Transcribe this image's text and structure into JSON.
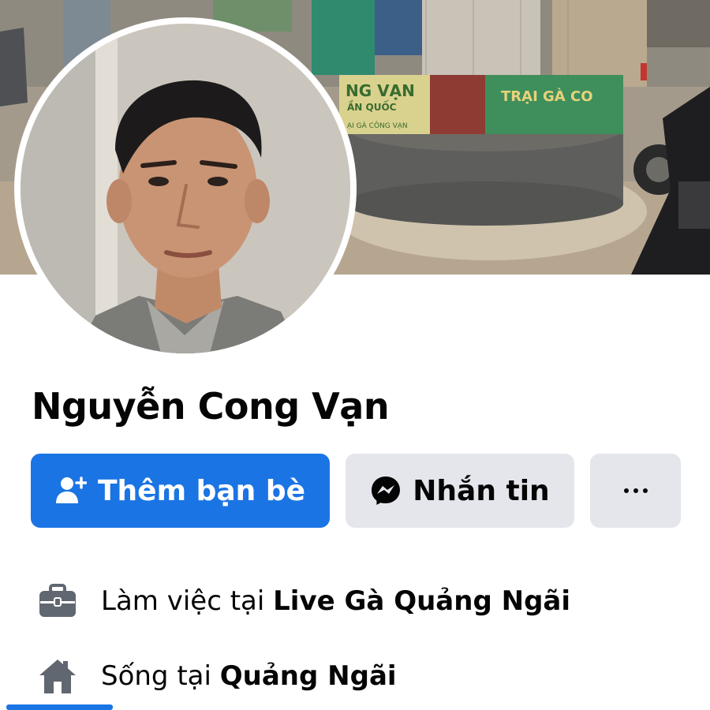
{
  "profile": {
    "name": "Nguyễn Cong Vạn"
  },
  "cover": {
    "banner_text_left": "NG VẠN",
    "banner_subtext_left": "ẦN QUỐC",
    "banner_text_right": "TRẠI GÀ CO",
    "banner_caption": "ẠI GÀ CÔNG VẠN"
  },
  "actions": {
    "add_friend_label": "Thêm bạn bè",
    "add_friend_icon": "person-add-icon",
    "message_label": "Nhắn tin",
    "message_icon": "messenger-icon",
    "more_icon": "more-dots-icon"
  },
  "intro": {
    "work_prefix": "Làm việc tại ",
    "work_place": "Live Gà Quảng Ngãi",
    "work_icon": "briefcase-icon",
    "home_prefix": "Sống tại ",
    "home_place": "Quảng Ngãi",
    "home_icon": "house-icon"
  },
  "colors": {
    "primary_button": "#1b74e4",
    "secondary_button": "#e4e6eb",
    "text": "#050505",
    "icon": "#606770"
  }
}
